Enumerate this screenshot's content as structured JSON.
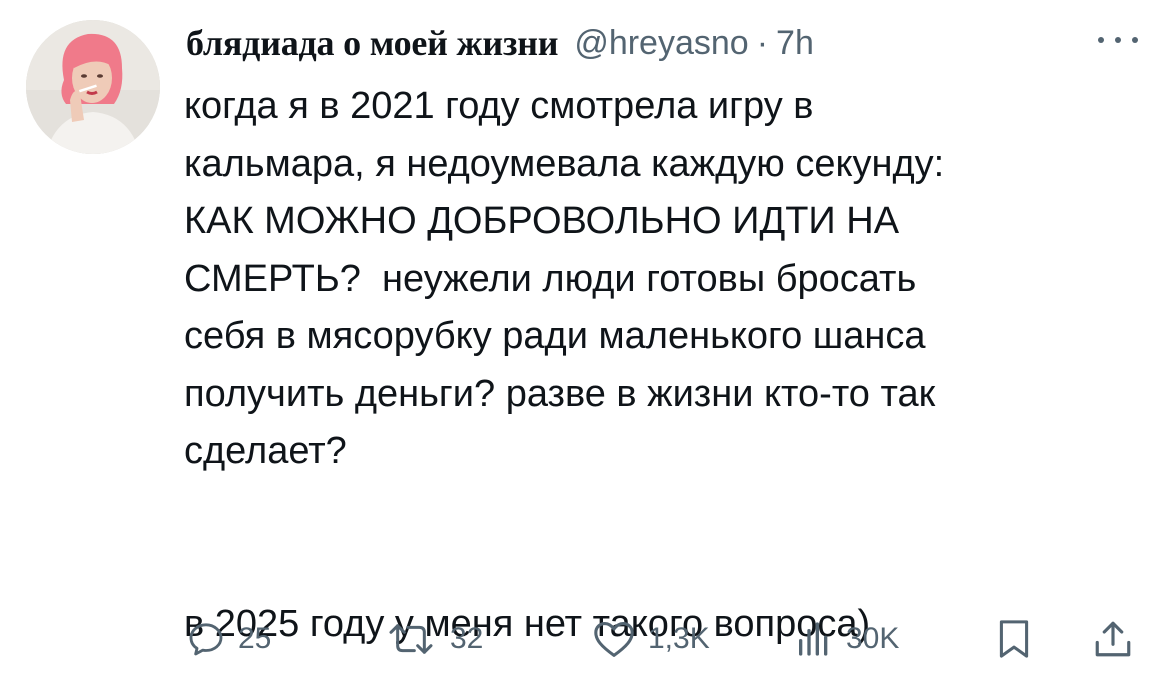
{
  "author": {
    "display_name": "блядиада о моей жизни",
    "handle": "@hreyasno",
    "separator": "·",
    "time": "7h"
  },
  "tweet": {
    "text": "когда я в 2021 году смотрела игру в\nкальмара, я недоумевала каждую секунду:\nКАК МОЖНО ДОБРОВОЛЬНО ИДТИ НА\nСМЕРТЬ?  неужели люди готовы бросать\nсебя в мясорубку ради маленького шанса\nполучить деньги? разве в жизни кто-то так\nсделает?\n\n\nв 2025 году у меня нет такого вопроса)"
  },
  "actions": {
    "reply_count": "25",
    "repost_count": "32",
    "like_count": "1,3K",
    "views_count": "30K"
  },
  "icons": {
    "more": "more-horizontal-icon",
    "reply": "reply-icon",
    "repost": "repost-icon",
    "like": "heart-icon",
    "views": "views-icon",
    "bookmark": "bookmark-icon",
    "share": "share-icon"
  },
  "colors": {
    "text": "#0f1419",
    "secondary": "#536471",
    "background": "#ffffff"
  }
}
